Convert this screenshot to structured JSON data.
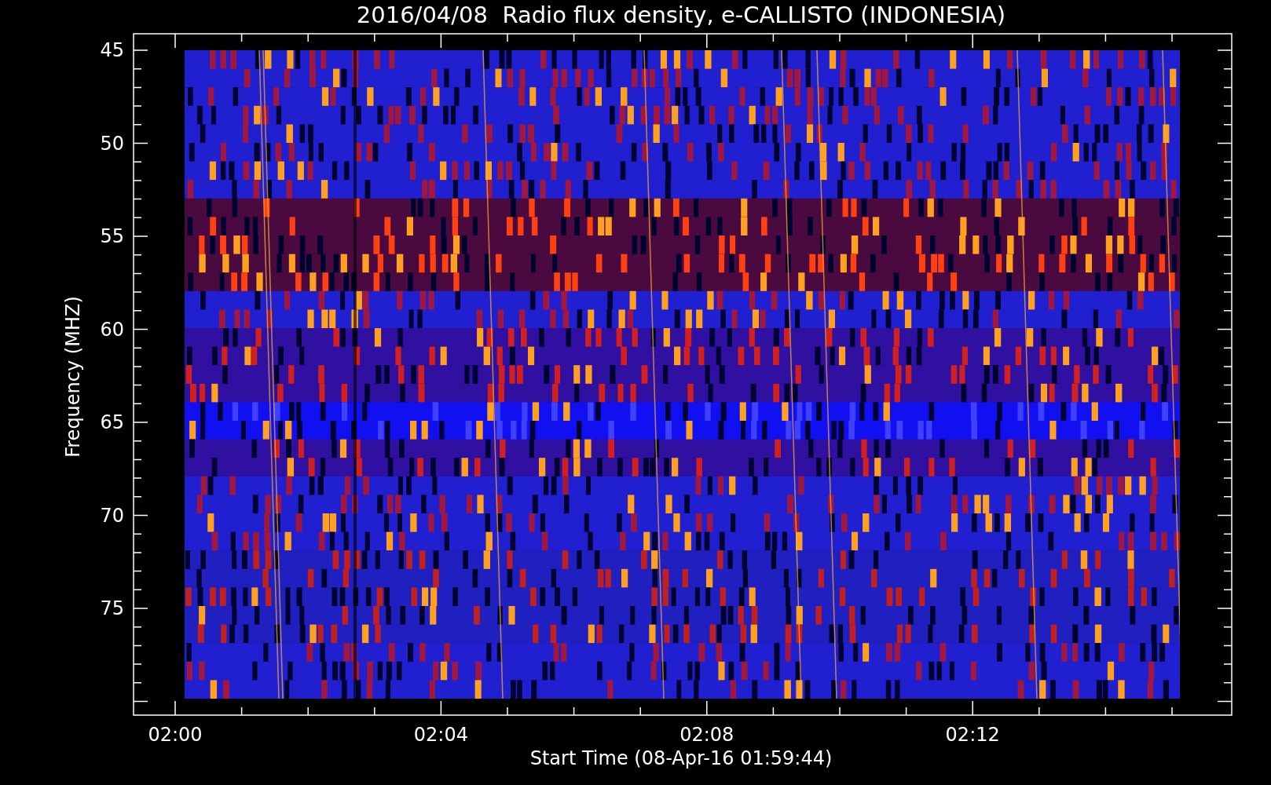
{
  "plot": {
    "title": "2016/04/08  Radio flux density, e-CALLISTO (INDONESIA)",
    "y_axis": {
      "label": "Frequency (MHZ)",
      "ticks": [
        "45",
        "50",
        "55",
        "60",
        "65",
        "70",
        "75"
      ]
    },
    "x_axis": {
      "label": "Start Time (08-Apr-16 01:59:44)",
      "ticks": [
        "02:00",
        "02:04",
        "02:08",
        "02:12"
      ]
    }
  }
}
